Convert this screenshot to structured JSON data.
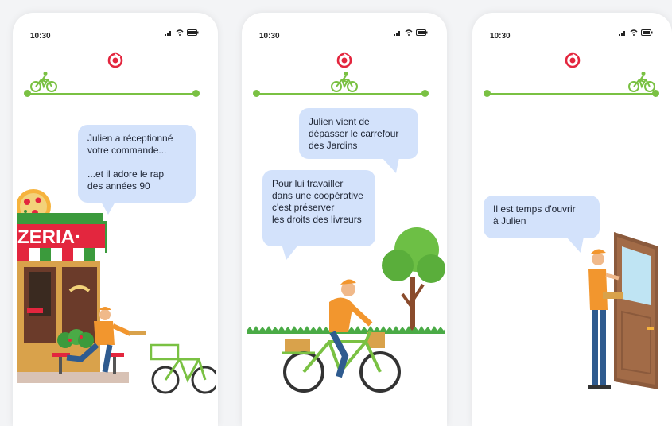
{
  "colors": {
    "accent_green": "#7ac143",
    "bubble_bg": "#d3e2fb",
    "brand_red": "#e3263e",
    "jacket_orange": "#f2962e"
  },
  "icons": [
    "signal-icon",
    "wifi-icon",
    "battery-icon",
    "brand-logo-icon",
    "bike-icon"
  ],
  "screens": [
    {
      "time": "10:30",
      "progress_fraction": 0.05,
      "messages": [
        "Julien a réceptionné\nvotre commande...\n\n...et il adore le rap\ndes années 90"
      ],
      "sign_text": "ZERIA·"
    },
    {
      "time": "10:30",
      "progress_fraction": 0.5,
      "messages": [
        "Julien vient de\ndépasser le carrefour\ndes Jardins",
        "Pour lui travailler\ndans une coopérative\nc'est préserver\nles droits des livreurs"
      ]
    },
    {
      "time": "10:30",
      "progress_fraction": 0.95,
      "messages": [
        "Il est temps d'ouvrir\nà Julien"
      ]
    }
  ]
}
